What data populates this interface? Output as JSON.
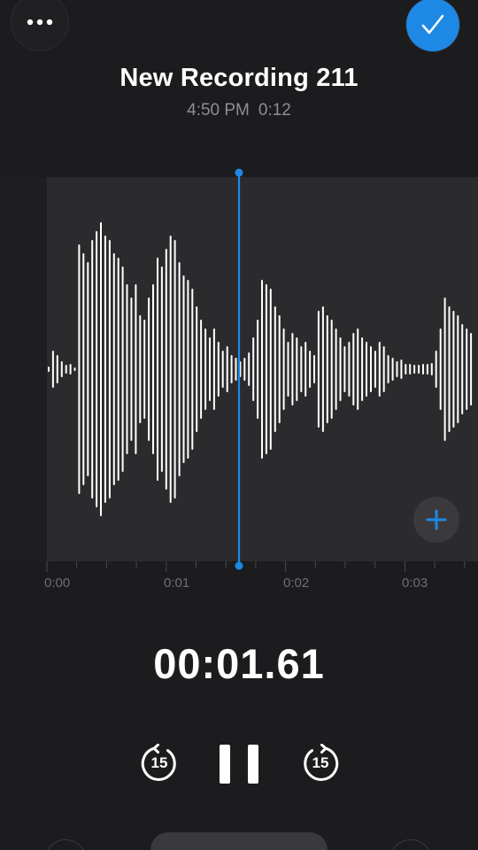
{
  "header": {
    "title": "New Recording 211",
    "time": "4:50 PM",
    "duration": "0:12"
  },
  "timeline": {
    "tick_labels": [
      "0:00",
      "0:01",
      "0:02",
      "0:03"
    ],
    "playhead_seconds": 1.61
  },
  "playback": {
    "current_time": "00:01.61",
    "skip_back_seconds": "15",
    "skip_forward_seconds": "15"
  },
  "icons": {
    "more": "more-icon",
    "done": "checkmark-icon",
    "add": "plus-icon",
    "skip_back": "skip-back-15-icon",
    "pause": "pause-icon",
    "skip_forward": "skip-forward-15-icon"
  },
  "colors": {
    "accent": "#1e88e5",
    "background": "#1c1c1e",
    "waveform": "#ffffff",
    "secondary_text": "#8e8e93"
  }
}
